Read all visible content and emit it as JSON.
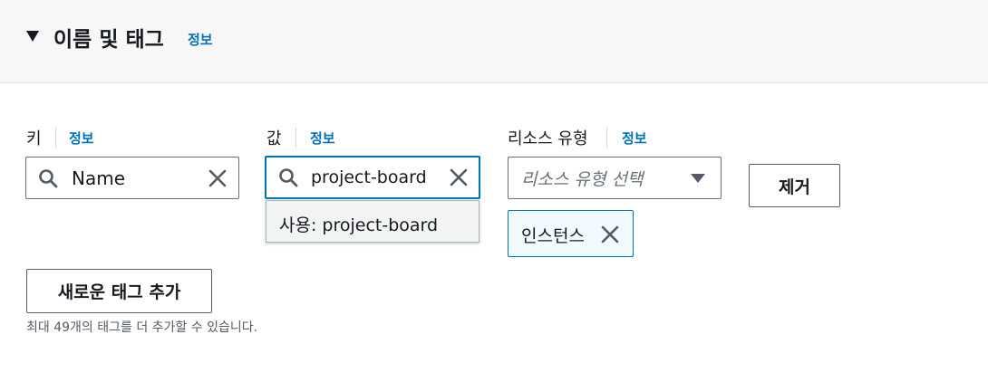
{
  "section": {
    "title": "이름 및 태그",
    "info": "정보"
  },
  "key": {
    "label": "키",
    "info": "정보",
    "value": "Name"
  },
  "value": {
    "label": "값",
    "info": "정보",
    "value": "project-board",
    "suggestion": "사용: project-board"
  },
  "resource_type": {
    "label": "리소스 유형",
    "info": "정보",
    "placeholder": "리소스 유형 선택",
    "selected_token": "인스턴스"
  },
  "remove_button": "제거",
  "add_tag_button": "새로운 태그 추가",
  "hint": "최대 49개의 태그를 더 추가할 수 있습니다.",
  "colors": {
    "link": "#0073bb",
    "focus_border": "#0073bb",
    "token_bg": "#f1faff",
    "header_bg": "#f7f7f8"
  },
  "icons": [
    "caret-down-icon",
    "search-icon",
    "clear-icon",
    "dropdown-arrow-icon",
    "dismiss-icon"
  ]
}
